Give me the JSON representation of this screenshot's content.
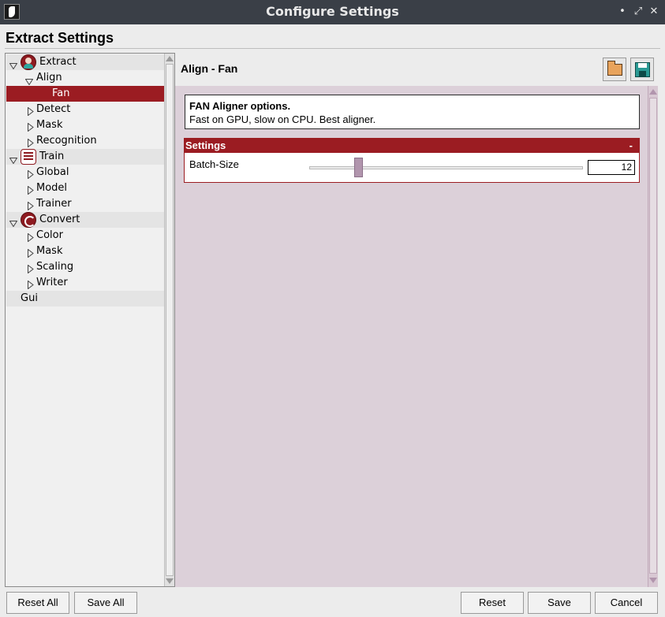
{
  "window": {
    "title": "Configure Settings",
    "heading": "Extract Settings",
    "minimize_glyph": "•",
    "maximize_glyph": "⤢",
    "close_glyph": "✕"
  },
  "tree": {
    "items": [
      {
        "label": "Extract",
        "level": 0,
        "kind": "category",
        "icon": "extract-face-icon",
        "expanded": true
      },
      {
        "label": "Align",
        "level": 1,
        "expanded": true
      },
      {
        "label": "Fan",
        "level": 2,
        "selected": true
      },
      {
        "label": "Detect",
        "level": 1,
        "expanded": false
      },
      {
        "label": "Mask",
        "level": 1,
        "expanded": false
      },
      {
        "label": "Recognition",
        "level": 1,
        "expanded": false
      },
      {
        "label": "Train",
        "level": 0,
        "kind": "category",
        "icon": "train-list-icon",
        "expanded": true
      },
      {
        "label": "Global",
        "level": 1,
        "expanded": false
      },
      {
        "label": "Model",
        "level": 1,
        "expanded": false
      },
      {
        "label": "Trainer",
        "level": 1,
        "expanded": false
      },
      {
        "label": "Convert",
        "level": 0,
        "kind": "category",
        "icon": "convert-icon",
        "expanded": true
      },
      {
        "label": "Color",
        "level": 1,
        "expanded": false
      },
      {
        "label": "Mask",
        "level": 1,
        "expanded": false
      },
      {
        "label": "Scaling",
        "level": 1,
        "expanded": false
      },
      {
        "label": "Writer",
        "level": 1,
        "expanded": false
      },
      {
        "label": "Gui",
        "level": 0,
        "kind": "category"
      }
    ]
  },
  "panel": {
    "title": "Align - Fan",
    "info_title": "FAN Aligner options.",
    "info_desc": "Fast on GPU, slow on CPU. Best aligner.",
    "group_title": "Settings",
    "collapse_label": "-",
    "batch_size": {
      "label": "Batch-Size",
      "value": "12",
      "slider_fraction": 0.17
    }
  },
  "buttons": {
    "reset_all": "Reset All",
    "save_all": "Save All",
    "reset": "Reset",
    "save": "Save",
    "cancel": "Cancel"
  },
  "colors": {
    "accent": "#9b1c22",
    "content_bg": "#dcd0d9",
    "slider_handle": "#b195ad"
  }
}
